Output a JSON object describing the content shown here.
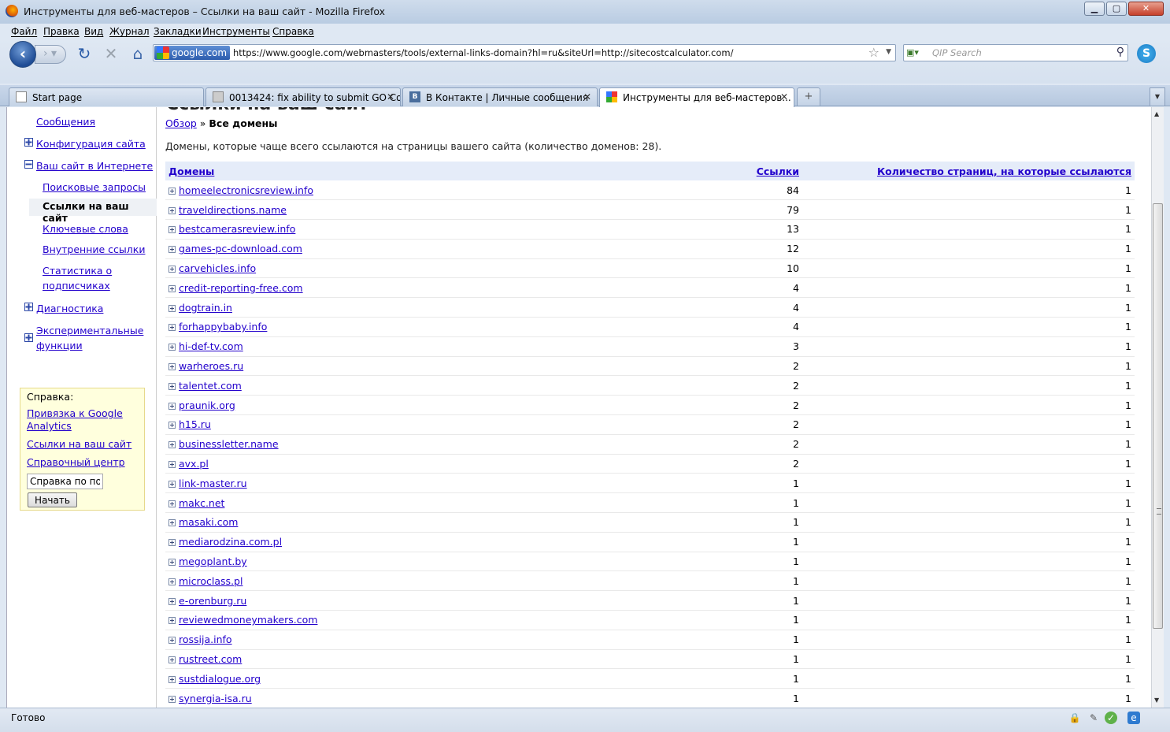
{
  "window": {
    "title": "Инструменты для веб-мастеров – Ссылки на ваш сайт - Mozilla Firefox",
    "minimize": "▁",
    "maximize": "▢",
    "close": "✕"
  },
  "menu": [
    "Файл",
    "Правка",
    "Вид",
    "Журнал",
    "Закладки",
    "Инструменты",
    "Справка"
  ],
  "nav": {
    "site_identity": "google.com",
    "url": "https://www.google.com/webmasters/tools/external-links-domain?hl=ru&siteUrl=http://sitecostcalculator.com/",
    "search_placeholder": "QIP Search"
  },
  "tabs": [
    {
      "label": "Start page",
      "icon": "page-icon",
      "active": false
    },
    {
      "label": "0013424: fix ability to submit GO Co...",
      "icon": "bug-icon",
      "active": false
    },
    {
      "label": "В Контакте | Личные сообщения",
      "icon": "vk-icon",
      "active": false
    },
    {
      "label": "Инструменты для веб-мастеров...",
      "icon": "google-icon",
      "active": true
    }
  ],
  "page": {
    "clipped_title": "Ссылки на ваш сайт",
    "breadcrumb_link": "Обзор",
    "breadcrumb_sep": " » ",
    "breadcrumb_current": "Все домены",
    "description": "Домены, которые чаще всего ссылаются на страницы вашего сайта (количество доменов: 28)."
  },
  "sidebar": {
    "messages": "Сообщения",
    "site_config": "Конфигурация сайта",
    "site_on_web": "Ваш сайт в Интернете",
    "search_queries": "Поисковые запросы",
    "links_to_site": "Ссылки на ваш сайт",
    "keywords": "Ключевые слова",
    "internal_links": "Внутренние ссылки",
    "subscriber_stats": "Статистика о подписчиках",
    "diagnostics": "Диагностика",
    "labs": "Экспериментальные функции"
  },
  "help": {
    "title": "Справка:",
    "link_analytics": "Привязка к Google Analytics",
    "link_links": "Ссылки на ваш сайт",
    "link_center": "Справочный центр",
    "search_value": "Справка по пои",
    "search_button": "Начать"
  },
  "table": {
    "headers": {
      "domains": "Домены",
      "links": "Ссылки",
      "pages": "Количество страниц, на которые ссылаются"
    },
    "rows": [
      {
        "domain": "homeelectronicsreview.info",
        "links": "84",
        "pages": "1"
      },
      {
        "domain": "traveldirections.name",
        "links": "79",
        "pages": "1"
      },
      {
        "domain": "bestcamerasreview.info",
        "links": "13",
        "pages": "1"
      },
      {
        "domain": "games-pc-download.com",
        "links": "12",
        "pages": "1"
      },
      {
        "domain": "carvehicles.info",
        "links": "10",
        "pages": "1"
      },
      {
        "domain": "credit-reporting-free.com",
        "links": "4",
        "pages": "1"
      },
      {
        "domain": "dogtrain.in",
        "links": "4",
        "pages": "1"
      },
      {
        "domain": "forhappybaby.info",
        "links": "4",
        "pages": "1"
      },
      {
        "domain": "hi-def-tv.com",
        "links": "3",
        "pages": "1"
      },
      {
        "domain": "warheroes.ru",
        "links": "2",
        "pages": "1"
      },
      {
        "domain": "talentet.com",
        "links": "2",
        "pages": "1"
      },
      {
        "domain": "praunik.org",
        "links": "2",
        "pages": "1"
      },
      {
        "domain": "h15.ru",
        "links": "2",
        "pages": "1"
      },
      {
        "domain": "businessletter.name",
        "links": "2",
        "pages": "1"
      },
      {
        "domain": "avx.pl",
        "links": "2",
        "pages": "1"
      },
      {
        "domain": "link-master.ru",
        "links": "1",
        "pages": "1"
      },
      {
        "domain": "makc.net",
        "links": "1",
        "pages": "1"
      },
      {
        "domain": "masaki.com",
        "links": "1",
        "pages": "1"
      },
      {
        "domain": "mediarodzina.com.pl",
        "links": "1",
        "pages": "1"
      },
      {
        "domain": "megoplant.by",
        "links": "1",
        "pages": "1"
      },
      {
        "domain": "microclass.pl",
        "links": "1",
        "pages": "1"
      },
      {
        "domain": "e-orenburg.ru",
        "links": "1",
        "pages": "1"
      },
      {
        "domain": "reviewedmoneymakers.com",
        "links": "1",
        "pages": "1"
      },
      {
        "domain": "rossija.info",
        "links": "1",
        "pages": "1"
      },
      {
        "domain": "rustreet.com",
        "links": "1",
        "pages": "1"
      },
      {
        "domain": "sustdialogue.org",
        "links": "1",
        "pages": "1"
      },
      {
        "domain": "synergia-isa.ru",
        "links": "1",
        "pages": "1"
      }
    ]
  },
  "status": {
    "text": "Готово"
  },
  "colors": {
    "link": "#2200cc",
    "header_bg": "#e5ecf9",
    "help_bg": "#ffffdd"
  }
}
